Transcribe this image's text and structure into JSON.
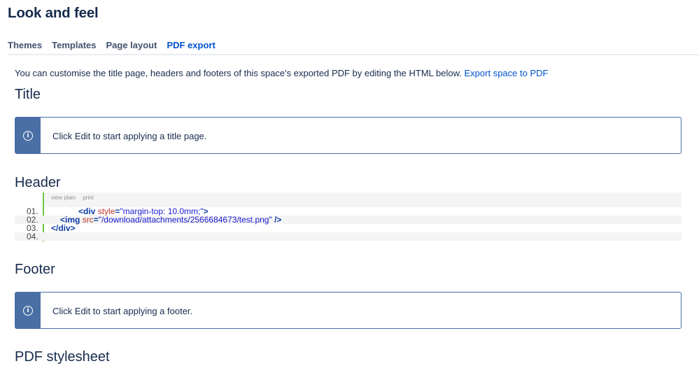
{
  "page": {
    "title": "Look and feel"
  },
  "tabs": [
    {
      "label": "Themes",
      "active": false
    },
    {
      "label": "Templates",
      "active": false
    },
    {
      "label": "Page layout",
      "active": false
    },
    {
      "label": "PDF export",
      "active": true
    }
  ],
  "intro": {
    "text": "You can customise the title page, headers and footers of this space's exported PDF by editing the HTML below.",
    "link": "Export space to PDF"
  },
  "sections": {
    "title": {
      "heading": "Title",
      "info": "Click Edit to start applying a title page."
    },
    "header": {
      "heading": "Header",
      "toolbar": {
        "view_plain": "view plain",
        "print": "print"
      },
      "lines": [
        {
          "num": "01.",
          "tag_open": "<div",
          "attr": "style",
          "eq": "=",
          "value": "\"margin-top: 10.0mm;\"",
          "tag_close": ">"
        },
        {
          "num": "02.",
          "tag_open": "<img",
          "attr": "src",
          "eq": "=",
          "value": "\"/download/attachments/2566684673/test.png\"",
          "tag_close": " />"
        },
        {
          "num": "03.",
          "tag_open": "</div>"
        },
        {
          "num": "04."
        }
      ]
    },
    "footer": {
      "heading": "Footer",
      "info": "Click Edit to start applying a footer."
    },
    "stylesheet": {
      "heading": "PDF stylesheet"
    }
  },
  "colors": {
    "accent": "#0052cc",
    "info_border": "#4a6fa5",
    "code_border": "#6cc644"
  }
}
